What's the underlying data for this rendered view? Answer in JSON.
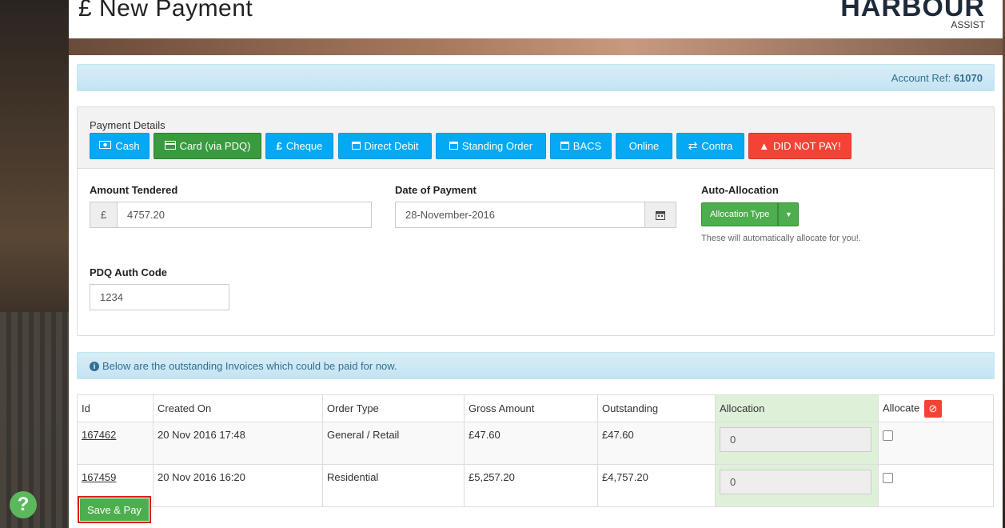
{
  "header": {
    "title": "£ New Payment",
    "logo_main": "HARBOUR",
    "logo_sub": "ASSIST"
  },
  "account": {
    "label": "Account Ref:",
    "ref": "61070"
  },
  "payment_details": {
    "label": "Payment Details",
    "methods": [
      {
        "label": "Cash",
        "icon": "cash-icon"
      },
      {
        "label": "Card (via PDQ)",
        "icon": "card-icon"
      },
      {
        "label": "Cheque",
        "icon": "pound-icon"
      },
      {
        "label": "Direct Debit",
        "icon": "calendar-icon"
      },
      {
        "label": "Standing Order",
        "icon": "calendar-icon"
      },
      {
        "label": "BACS",
        "icon": "calendar-icon"
      },
      {
        "label": "Online",
        "icon": ""
      },
      {
        "label": "Contra",
        "icon": "exchange-icon"
      },
      {
        "label": "DID NOT PAY!",
        "icon": "warning-icon"
      }
    ],
    "colors": {
      "info": "#03a9f4",
      "selected": "#3a9a3e",
      "danger": "#f44336"
    }
  },
  "form": {
    "amount_label": "Amount Tendered",
    "currency": "£",
    "amount_value": "4757.20",
    "date_label": "Date of Payment",
    "date_value": "28-November-2016",
    "auto_label": "Auto-Allocation",
    "allocation_button": "Allocation Type",
    "auto_help": "These will automatically allocate for you!.",
    "pdq_label": "PDQ Auth Code",
    "pdq_value": "1234"
  },
  "info": {
    "text": "Below are the outstanding Invoices which could be paid for now."
  },
  "table": {
    "headers": [
      "Id",
      "Created On",
      "Order Type",
      "Gross Amount",
      "Outstanding",
      "Allocation",
      "Allocate"
    ],
    "rows": [
      {
        "id": "167462",
        "created": "20 Nov 2016 17:48",
        "type": "General / Retail",
        "gross": "£47.60",
        "outstanding": "£47.60",
        "allocation": "0"
      },
      {
        "id": "167459",
        "created": "20 Nov 2016 16:20",
        "type": "Residential",
        "gross": "£5,257.20",
        "outstanding": "£4,757.20",
        "allocation": "0"
      }
    ]
  },
  "actions": {
    "save": "Save & Pay"
  },
  "help": {
    "symbol": "?"
  }
}
